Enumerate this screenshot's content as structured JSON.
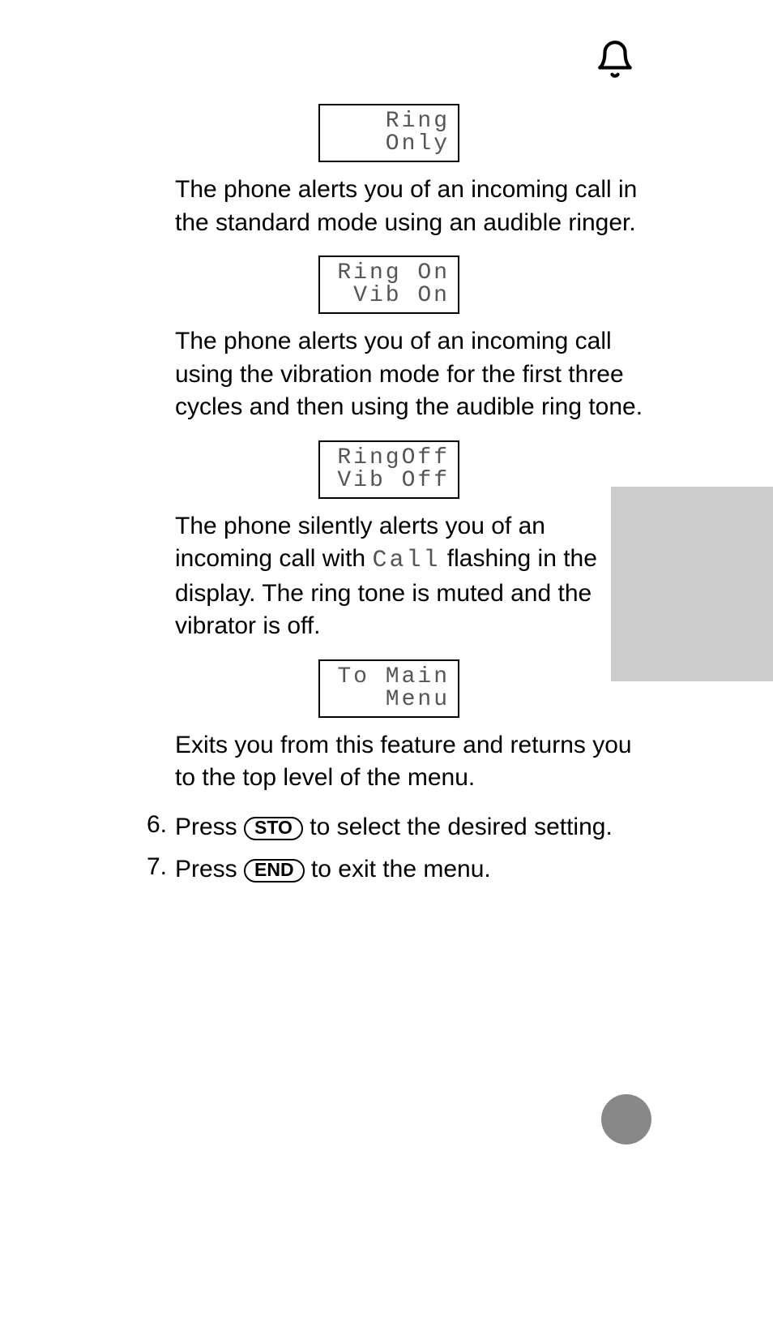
{
  "header": {
    "icon": "bell-icon"
  },
  "sections": [
    {
      "lcd_line1": "Ring",
      "lcd_line2": "Only",
      "desc": "The phone alerts you of an incoming call in the standard mode using an audible ringer."
    },
    {
      "lcd_line1": "Ring On",
      "lcd_line2": "Vib On",
      "desc": "The phone alerts you of an incoming call using the vibration mode for the first three cycles and then using the audible ring tone."
    },
    {
      "lcd_line1": "RingOff",
      "lcd_line2": "Vib Off",
      "desc_pre": "The phone silently alerts you of an incoming call with ",
      "desc_lcd_inline": "Call",
      "desc_post": " flashing in the display. The ring tone is muted and the vibrator is off."
    },
    {
      "lcd_line1": "To Main",
      "lcd_line2": "Menu",
      "desc": "Exits you from this feature and returns you to the top level of the menu."
    }
  ],
  "steps": [
    {
      "num": "6.",
      "pre": "Press ",
      "key": "STO",
      "post": " to select the desired setting."
    },
    {
      "num": "7.",
      "pre": "Press ",
      "key": "END",
      "post": " to exit the menu."
    }
  ]
}
